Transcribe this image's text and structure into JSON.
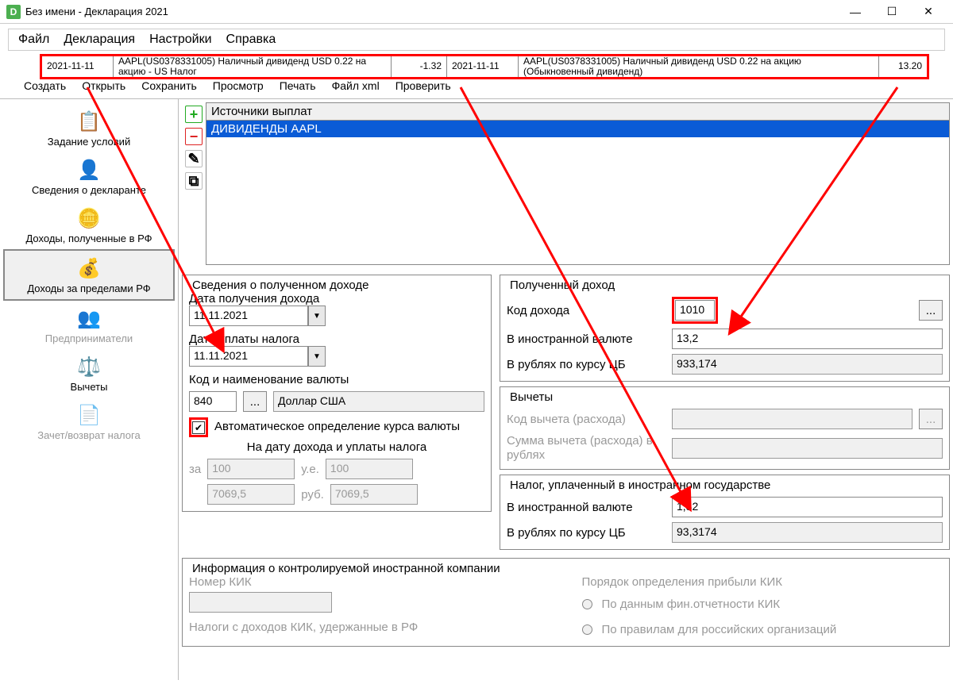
{
  "window": {
    "icon": "D",
    "title": "Без имени - Декларация 2021"
  },
  "menubar": [
    "Файл",
    "Декларация",
    "Настройки",
    "Справка"
  ],
  "datastrip": {
    "c1": "2021-11-11",
    "c2": "AAPL(US0378331005) Наличный дивиденд USD 0.22 на акцию - US Налог",
    "c3": "-1.32",
    "c4": "2021-11-11",
    "c5": "AAPL(US0378331005) Наличный дивиденд USD 0.22 на акцию (Обыкновенный дивиденд)",
    "c6": "13.20"
  },
  "toolbar": [
    "Создать",
    "Открыть",
    "Сохранить",
    "Просмотр",
    "Печать",
    "Файл xml",
    "Проверить"
  ],
  "sidebar": {
    "items": [
      {
        "label": "Задание условий",
        "enabled": true
      },
      {
        "label": "Сведения о декларанте",
        "enabled": true
      },
      {
        "label": "Доходы, полученные в РФ",
        "enabled": true
      },
      {
        "label": "Доходы за пределами РФ",
        "enabled": true,
        "selected": true
      },
      {
        "label": "Предприниматели",
        "enabled": false
      },
      {
        "label": "Вычеты",
        "enabled": true
      },
      {
        "label": "Зачет/возврат налога",
        "enabled": false
      }
    ]
  },
  "sources": {
    "header": "Источники выплат",
    "row": "ДИВИДЕНДЫ AAPL"
  },
  "left": {
    "legend": "Сведения о полученном доходе",
    "date_income_label": "Дата получения дохода",
    "date_income": "11.11.2021",
    "date_tax_label": "Дата уплаты налога",
    "date_tax": "11.11.2021",
    "currency_label": "Код и наименование валюты",
    "currency_code": "840",
    "currency_name": "Доллар США",
    "auto_rate_label": "Автоматическое определение курса валюты",
    "rate_header": "На дату дохода и уплаты налога",
    "za": "за",
    "za_v": "100",
    "ue": "у.е.",
    "ue_v": "100",
    "rub": "руб.",
    "rub1": "7069,5",
    "rub2": "7069,5"
  },
  "right": {
    "income_legend": "Полученный доход",
    "code_label": "Код дохода",
    "code": "1010",
    "fx_label": "В иностранной валюте",
    "fx": "13,2",
    "rub_label": "В рублях по курсу ЦБ",
    "rub": "933,174",
    "deduct_legend": "Вычеты",
    "deduct_code_label": "Код вычета (расхода)",
    "deduct_sum_label": "Сумма вычета (расхода) в рублях",
    "tax_legend": "Налог, уплаченный в иностранном государстве",
    "tax_fx_label": "В иностранной валюте",
    "tax_fx": "1,32",
    "tax_rub_label": "В рублях по курсу ЦБ",
    "tax_rub": "93,3174"
  },
  "kik": {
    "legend": "Информация о контролируемой иностранной компании",
    "num_label": "Номер КИК",
    "tax_label": "Налоги с доходов КИК, удержанные в РФ",
    "order_label": "Порядок определения прибыли КИК",
    "opt1": "По данным фин.отчетности КИК",
    "opt2": "По правилам для российских организаций"
  },
  "btn_more": "..."
}
